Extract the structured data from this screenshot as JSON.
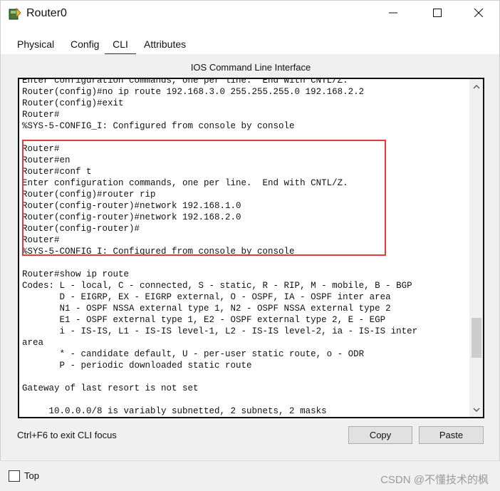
{
  "window": {
    "title": "Router0",
    "icon": "router-icon",
    "controls": [
      "minimize-icon",
      "maximize-icon",
      "close-icon"
    ]
  },
  "tabs": [
    {
      "label": "Physical",
      "active": false
    },
    {
      "label": "Config",
      "active": false
    },
    {
      "label": "CLI",
      "active": true
    },
    {
      "label": "Attributes",
      "active": false
    }
  ],
  "cli": {
    "title": "IOS Command Line Interface",
    "lines": [
      "Enter configuration commands, one per line.  End with CNTL/Z.",
      "Router(config)#no ip route 192.168.3.0 255.255.255.0 192.168.2.2",
      "Router(config)#exit",
      "Router#",
      "%SYS-5-CONFIG_I: Configured from console by console",
      "",
      "Router#",
      "Router#en",
      "Router#conf t",
      "Enter configuration commands, one per line.  End with CNTL/Z.",
      "Router(config)#router rip",
      "Router(config-router)#network 192.168.1.0",
      "Router(config-router)#network 192.168.2.0",
      "Router(config-router)#",
      "Router#",
      "%SYS-5-CONFIG_I: Configured from console by console",
      "",
      "Router#show ip route",
      "Codes: L - local, C - connected, S - static, R - RIP, M - mobile, B - BGP",
      "       D - EIGRP, EX - EIGRP external, O - OSPF, IA - OSPF inter area",
      "       N1 - OSPF NSSA external type 1, N2 - OSPF NSSA external type 2",
      "       E1 - OSPF external type 1, E2 - OSPF external type 2, E - EGP",
      "       i - IS-IS, L1 - IS-IS level-1, L2 - IS-IS level-2, ia - IS-IS inter",
      "area",
      "       * - candidate default, U - per-user static route, o - ODR",
      "       P - periodic downloaded static route",
      "",
      "Gateway of last resort is not set",
      "",
      "     10.0.0.0/8 is variably subnetted, 2 subnets, 2 masks"
    ],
    "highlight_color": "#e8393c",
    "hint": "Ctrl+F6 to exit CLI focus",
    "copy_label": "Copy",
    "paste_label": "Paste"
  },
  "footer": {
    "top_label": "Top",
    "top_checked": false,
    "watermark": "CSDN @不懂技术的枫"
  }
}
